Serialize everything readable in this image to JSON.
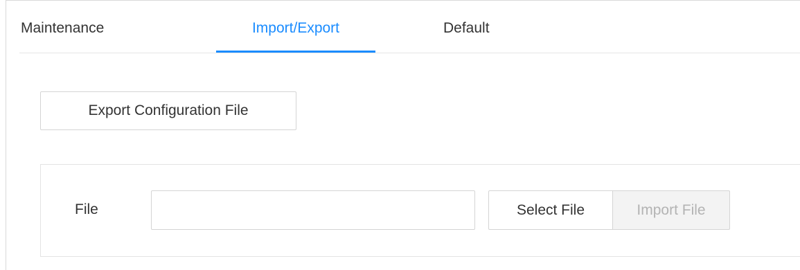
{
  "tabs": [
    {
      "label": "Maintenance",
      "active": false
    },
    {
      "label": "Import/Export",
      "active": true
    },
    {
      "label": "Default",
      "active": false
    }
  ],
  "colors": {
    "accent": "#1a8cff",
    "text": "#333333",
    "disabled_text": "#b3b3b3",
    "border": "#d4d4d4"
  },
  "export": {
    "button_label": "Export Configuration File"
  },
  "import": {
    "file_label": "File",
    "file_value": "",
    "select_button_label": "Select File",
    "import_button_label": "Import File",
    "import_button_enabled": false
  }
}
